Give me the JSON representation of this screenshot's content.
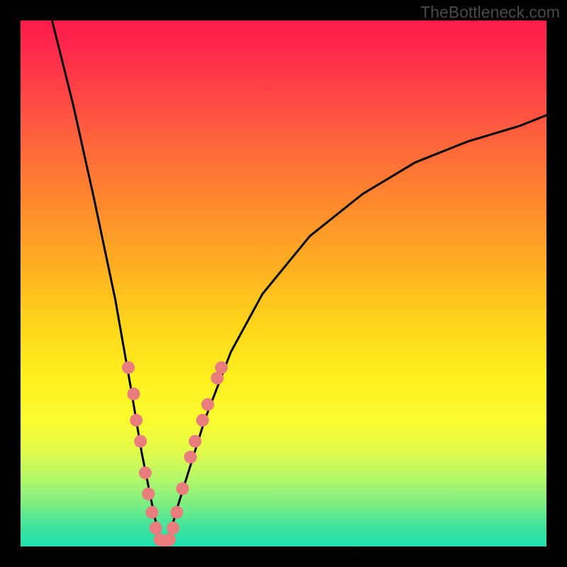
{
  "watermark": "TheBottleneck.com",
  "chart_data": {
    "type": "line",
    "title": "",
    "xlabel": "",
    "ylabel": "",
    "xlim": [
      0,
      100
    ],
    "ylim": [
      0,
      100
    ],
    "curve": {
      "name": "bottleneck-curve",
      "comment": "V-shaped curve; values estimated from pixel positions since axes have no tick labels",
      "x": [
        6,
        10,
        14,
        18,
        21,
        23,
        25,
        26.5,
        28,
        30,
        35,
        40,
        46,
        55,
        65,
        75,
        85,
        95,
        100
      ],
      "y": [
        100,
        84,
        66,
        47,
        30,
        18,
        8,
        1,
        1,
        8,
        24,
        37,
        48,
        59,
        67,
        73,
        77,
        80,
        82
      ]
    },
    "scatter": {
      "name": "sample-points",
      "comment": "salmon dots clustered around the V minimum; approximate pixel-read values",
      "color": "#e97c7c",
      "points": [
        {
          "x": 20.5,
          "y": 34
        },
        {
          "x": 21.5,
          "y": 29
        },
        {
          "x": 22,
          "y": 24
        },
        {
          "x": 22.8,
          "y": 20
        },
        {
          "x": 23.7,
          "y": 14
        },
        {
          "x": 24.3,
          "y": 10
        },
        {
          "x": 25,
          "y": 6.5
        },
        {
          "x": 25.7,
          "y": 3.5
        },
        {
          "x": 26.5,
          "y": 1.3
        },
        {
          "x": 27.5,
          "y": 1
        },
        {
          "x": 28.3,
          "y": 1.3
        },
        {
          "x": 29,
          "y": 3.5
        },
        {
          "x": 29.7,
          "y": 6.5
        },
        {
          "x": 30.8,
          "y": 11
        },
        {
          "x": 32.3,
          "y": 17
        },
        {
          "x": 33.2,
          "y": 20
        },
        {
          "x": 34.6,
          "y": 24
        },
        {
          "x": 35.6,
          "y": 27
        },
        {
          "x": 37.4,
          "y": 32
        },
        {
          "x": 38.2,
          "y": 34
        }
      ]
    }
  }
}
